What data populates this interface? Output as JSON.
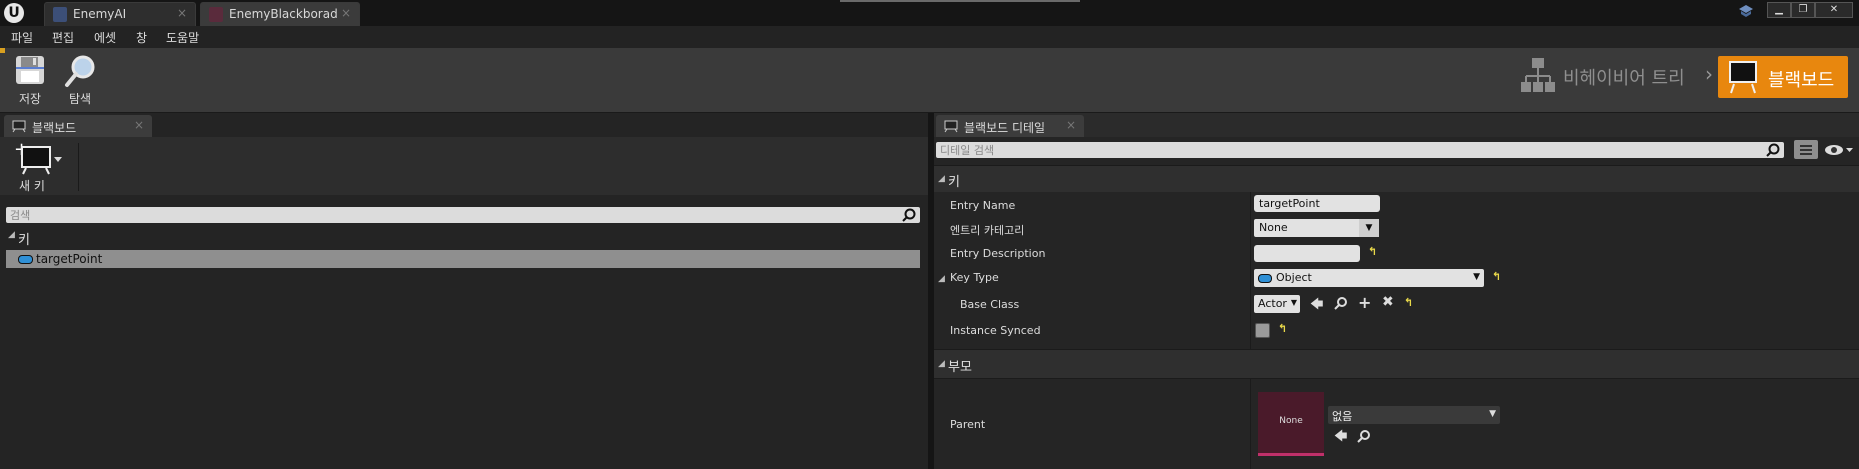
{
  "window": {
    "tabs": [
      {
        "label": "EnemyAI",
        "close": "×"
      },
      {
        "label": "EnemyBlackborad",
        "close": "×"
      }
    ],
    "controls": {
      "minimize": "▁",
      "maximize": "❐",
      "close": "✕"
    },
    "logo": "U"
  },
  "menu": {
    "items": [
      "파일",
      "편집",
      "에셋",
      "창",
      "도움말"
    ]
  },
  "toolbar": {
    "save_label": "저장",
    "browse_label": "탐색"
  },
  "mode_switcher": {
    "behavior_tree_label": "비헤이비어 트리",
    "separator": "›",
    "blackboard_label": "블랙보드",
    "active_color": "#e8870e"
  },
  "blackboard_panel": {
    "tab_label": "블랙보드",
    "tab_close": "×",
    "new_key_label": "새 키",
    "search_placeholder": "검색",
    "section_label": "키",
    "keys": [
      {
        "name": "targetPoint"
      }
    ]
  },
  "details_panel": {
    "tab_label": "블랙보드 디테일",
    "tab_close": "×",
    "search_placeholder": "디테일 검색",
    "key_section": "키",
    "props": {
      "entry_name_label": "Entry Name",
      "entry_name_value": "targetPoint",
      "entry_category_label": "엔트리 카테고리",
      "entry_category_value": "None",
      "entry_description_label": "Entry Description",
      "entry_description_value": "",
      "key_type_label": "Key Type",
      "key_type_value": "Object",
      "base_class_label": "Base Class",
      "base_class_value": "Actor",
      "instance_synced_label": "Instance Synced",
      "instance_synced_checked": false
    },
    "parent_section": "부모",
    "parent_label": "Parent",
    "parent_thumbnail_text": "None",
    "parent_value": "없음"
  }
}
